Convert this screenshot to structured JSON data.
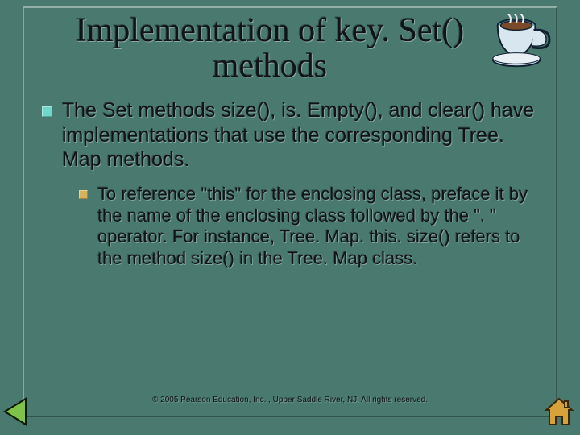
{
  "title": "Implementation of key. Set() methods",
  "bullets": {
    "level1": "The Set methods size(), is. Empty(), and clear() have implementations that use the corresponding Tree. Map methods.",
    "level2": "To reference \"this\" for the enclosing class, preface it by the name of the enclosing class followed by the \". \" operator. For instance, Tree. Map. this. size() refers to the method size() in the Tree. Map class."
  },
  "footer": "© 2005 Pearson Education, Inc. , Upper Saddle River, NJ.  All rights reserved.",
  "icons": {
    "cup": "teacup-icon",
    "prev": "prev-arrow-icon",
    "home": "home-icon"
  }
}
